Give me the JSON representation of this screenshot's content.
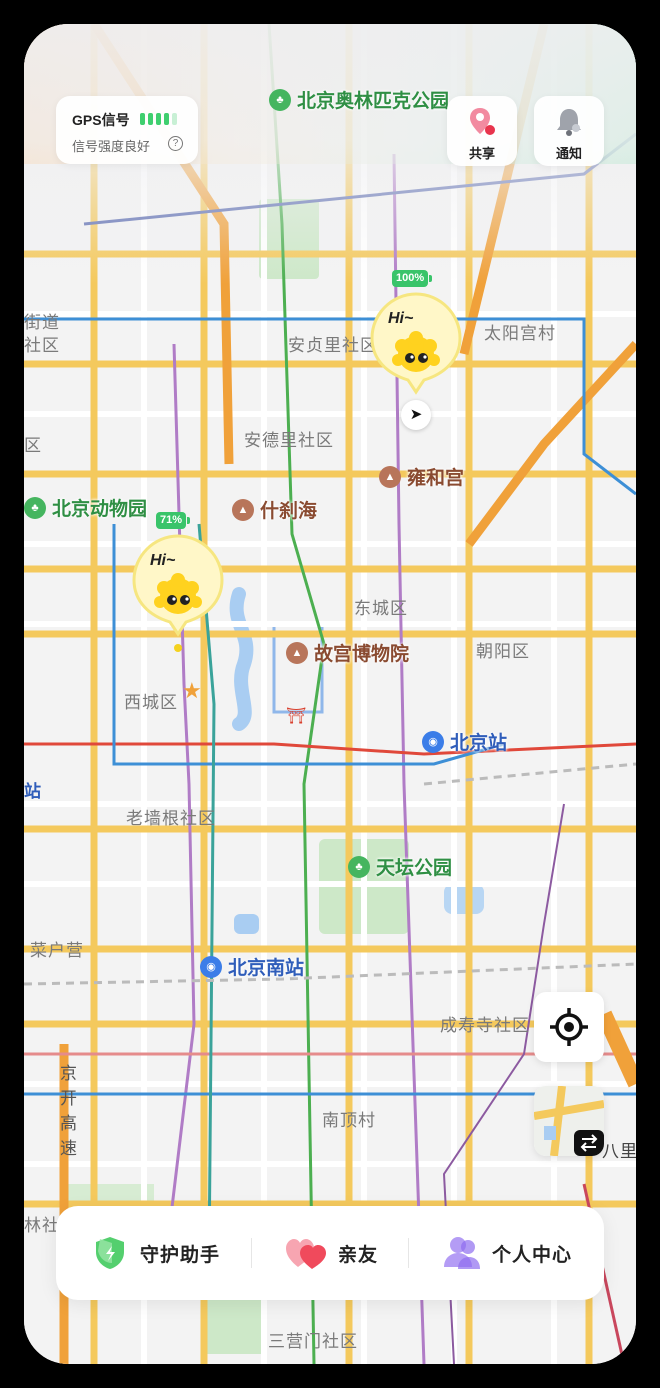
{
  "status": {
    "gps_title": "GPS信号",
    "gps_subtitle": "信号强度良好",
    "gps_bars_on": 4,
    "gps_bars_total": 5
  },
  "top_actions": {
    "share_label": "共享",
    "notify_label": "通知"
  },
  "map_labels": {
    "olympic_park": "北京奥林匹克公园",
    "zoo": "北京动物园",
    "shichahai": "什刹海",
    "yonghegong": "雍和宫",
    "palace_museum": "故宫博物院",
    "beijing_station": "北京站",
    "temple_of_heaven": "天坛公园",
    "beijing_south": "北京南站",
    "anzhenli": "安贞里社区",
    "taiyanggong": "太阳宫村",
    "andeli": "安德里社区",
    "dongcheng": "东城区",
    "chaoyang": "朝阳区",
    "xicheng": "西城区",
    "laoqianggen": "老墙根社区",
    "caihuying": "菜户营",
    "chengshousi": "成寿寺社区",
    "nandingcun": "南顶村",
    "sanyingmen": "三营门社区",
    "jie_dao": "街道",
    "she_qu_left": "社区",
    "qu_left": "区",
    "zhan_left": "站",
    "lin_she_qu": "林社区",
    "ba_li": "八里",
    "highway_jing": "京",
    "highway_kai": "开",
    "highway_gao": "高",
    "highway_su": "速"
  },
  "markers": [
    {
      "greeting": "Hi~",
      "battery": "100%"
    },
    {
      "greeting": "Hi~",
      "battery": "71%"
    }
  ],
  "bottom_nav": {
    "guard_label": "守护助手",
    "friends_label": "亲友",
    "profile_label": "个人中心"
  },
  "colors": {
    "gps_green": "#3fcf6f",
    "road_yellow": "#f4c95d",
    "ring_orange": "#f0a13a",
    "subway_green": "#4caf50",
    "subway_purple": "#b07cc6",
    "subway_blue": "#3d8fd6",
    "subway_red": "#e0483a"
  }
}
